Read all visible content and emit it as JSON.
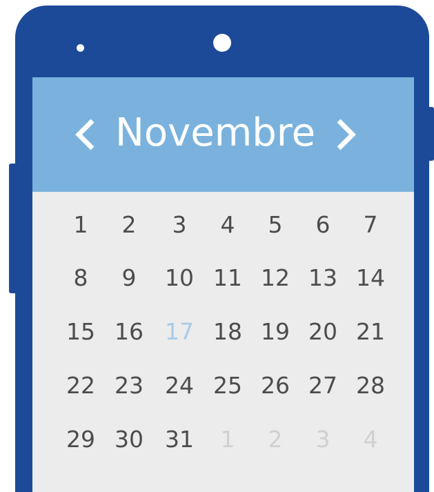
{
  "calendar": {
    "month": "Novembre",
    "prev_icon": "chevron-left-icon",
    "next_icon": "chevron-right-icon",
    "selected_day": "17",
    "weeks": [
      [
        {
          "d": "1"
        },
        {
          "d": "2"
        },
        {
          "d": "3"
        },
        {
          "d": "4"
        },
        {
          "d": "5"
        },
        {
          "d": "6"
        },
        {
          "d": "7"
        }
      ],
      [
        {
          "d": "8"
        },
        {
          "d": "9"
        },
        {
          "d": "10"
        },
        {
          "d": "11"
        },
        {
          "d": "12"
        },
        {
          "d": "13"
        },
        {
          "d": "14"
        }
      ],
      [
        {
          "d": "15"
        },
        {
          "d": "16"
        },
        {
          "d": "17",
          "state": "selected"
        },
        {
          "d": "18"
        },
        {
          "d": "19"
        },
        {
          "d": "20"
        },
        {
          "d": "21"
        }
      ],
      [
        {
          "d": "22"
        },
        {
          "d": "23"
        },
        {
          "d": "24"
        },
        {
          "d": "25"
        },
        {
          "d": "26"
        },
        {
          "d": "27"
        },
        {
          "d": "28"
        }
      ],
      [
        {
          "d": "29"
        },
        {
          "d": "30"
        },
        {
          "d": "31"
        },
        {
          "d": "1",
          "state": "faded"
        },
        {
          "d": "2",
          "state": "faded"
        },
        {
          "d": "3",
          "state": "faded"
        },
        {
          "d": "4",
          "state": "faded"
        }
      ]
    ]
  },
  "colors": {
    "phone_frame": "#1d4a98",
    "header": "#7ab2dd",
    "screen": "#ececec",
    "day_text": "#4c4c4c",
    "selected_day_text": "#a9cbe8",
    "other_month_text": "#d0d0d0"
  }
}
